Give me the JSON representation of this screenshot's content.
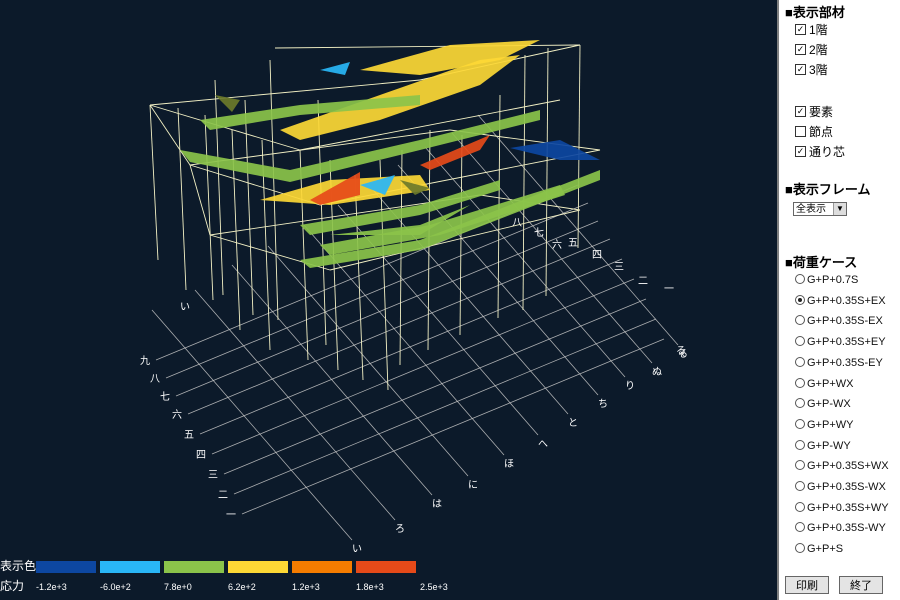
{
  "panel": {
    "display_members": {
      "title": "■表示部材",
      "items": [
        {
          "label": "1階",
          "checked": true
        },
        {
          "label": "2階",
          "checked": true
        },
        {
          "label": "3階",
          "checked": true
        }
      ]
    },
    "display_options": [
      {
        "label": "要素",
        "checked": true
      },
      {
        "label": "節点",
        "checked": false
      },
      {
        "label": "通り芯",
        "checked": true
      }
    ],
    "display_frame": {
      "title": "■表示フレーム",
      "selected": "全表示"
    },
    "load_cases": {
      "title": "■荷重ケース",
      "options": [
        {
          "label": "G+P+0.7S",
          "selected": false
        },
        {
          "label": "G+P+0.35S+EX",
          "selected": true
        },
        {
          "label": "G+P+0.35S-EX",
          "selected": false
        },
        {
          "label": "G+P+0.35S+EY",
          "selected": false
        },
        {
          "label": "G+P+0.35S-EY",
          "selected": false
        },
        {
          "label": "G+P+WX",
          "selected": false
        },
        {
          "label": "G+P-WX",
          "selected": false
        },
        {
          "label": "G+P+WY",
          "selected": false
        },
        {
          "label": "G+P-WY",
          "selected": false
        },
        {
          "label": "G+P+0.35S+WX",
          "selected": false
        },
        {
          "label": "G+P+0.35S-WX",
          "selected": false
        },
        {
          "label": "G+P+0.35S+WY",
          "selected": false
        },
        {
          "label": "G+P+0.35S-WY",
          "selected": false
        },
        {
          "label": "G+P+S",
          "selected": false
        }
      ]
    },
    "buttons": {
      "print": "印刷",
      "finish": "終了"
    }
  },
  "legend": {
    "color_label": "表示色",
    "value_label": "応力",
    "colors": [
      "#0d47a1",
      "#29b6f6",
      "#8bc34a",
      "#fdd835",
      "#f57c00",
      "#e64a19"
    ],
    "values": [
      "-1.2e+3",
      "-6.0e+2",
      "7.8e+0",
      "6.2e+2",
      "1.2e+3",
      "1.8e+3",
      "2.5e+3"
    ]
  },
  "grid_labels": {
    "left_axis": [
      "九",
      "八",
      "七",
      "六",
      "五",
      "四",
      "三",
      "二",
      "一"
    ],
    "front_axis": [
      "い",
      "ろ",
      "は",
      "に",
      "ほ",
      "へ",
      "と",
      "ち",
      "り",
      "ぬ",
      "る"
    ],
    "top_left": "い",
    "right_axis": [
      "八",
      "七",
      "六",
      "五",
      "四",
      "三",
      "二",
      "一"
    ],
    "right_top": "る"
  },
  "colors": {
    "background": "#0c1a2a",
    "frame_line": "#f2f0c4",
    "grid_line": "#c8c8c8"
  }
}
